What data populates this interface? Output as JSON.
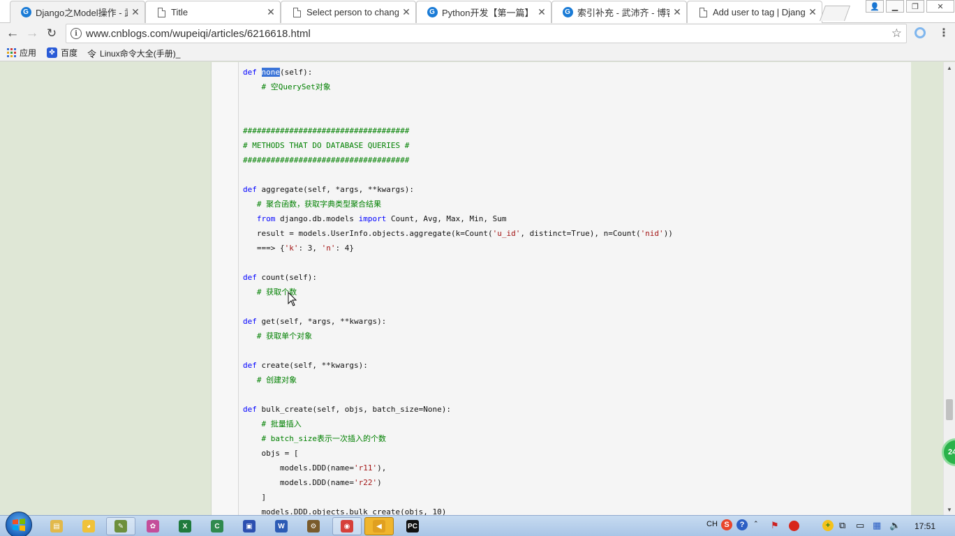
{
  "browser": {
    "tabs": [
      {
        "title": "Django之Model操作 - 武",
        "icon": "cnblogs-icon",
        "active": true
      },
      {
        "title": "Title",
        "icon": "document-icon",
        "active": false
      },
      {
        "title": "Select person to chang",
        "icon": "document-icon",
        "active": false
      },
      {
        "title": "Python开发【第一篇】",
        "icon": "cnblogs-icon",
        "active": false
      },
      {
        "title": "索引补充 - 武沛齐 - 博客",
        "icon": "cnblogs-icon",
        "active": false
      },
      {
        "title": "Add user to tag | Djang",
        "icon": "document-icon",
        "active": false
      }
    ],
    "tab_close_glyph": "✕",
    "address": "www.cnblogs.com/wupeiqi/articles/6216618.html",
    "bookmarks": [
      {
        "label": "应用",
        "icon": "apps-grid-icon"
      },
      {
        "label": "百度",
        "icon": "baidu-paw-icon"
      },
      {
        "label": "Linux命令大全(手册)_",
        "icon": "linux-icon"
      }
    ]
  },
  "code": {
    "lines": [
      [
        {
          "t": "def ",
          "c": "kw"
        },
        {
          "t": "none",
          "c": "sel"
        },
        {
          "t": "(self):",
          "c": ""
        }
      ],
      [
        {
          "t": "    # 空QuerySet对象",
          "c": "cm"
        }
      ],
      [],
      [],
      [
        {
          "t": "####################################",
          "c": "cm"
        }
      ],
      [
        {
          "t": "# METHODS THAT DO DATABASE QUERIES #",
          "c": "cm"
        }
      ],
      [
        {
          "t": "####################################",
          "c": "cm"
        }
      ],
      [],
      [
        {
          "t": "def ",
          "c": "kw"
        },
        {
          "t": "aggregate(self, *args, **kwargs):",
          "c": ""
        }
      ],
      [
        {
          "t": "   # 聚合函数，获取字典类型聚合结果",
          "c": "cm"
        }
      ],
      [
        {
          "t": "   ",
          "c": ""
        },
        {
          "t": "from",
          "c": "kw"
        },
        {
          "t": " django.db.models ",
          "c": ""
        },
        {
          "t": "import",
          "c": "kw"
        },
        {
          "t": " Count, Avg, Max, Min, Sum",
          "c": ""
        }
      ],
      [
        {
          "t": "   result = models.UserInfo.objects.aggregate(k=Count(",
          "c": ""
        },
        {
          "t": "'u_id'",
          "c": "st"
        },
        {
          "t": ", distinct=True), n=Count(",
          "c": ""
        },
        {
          "t": "'nid'",
          "c": "st"
        },
        {
          "t": "))",
          "c": ""
        }
      ],
      [
        {
          "t": "   ===> {",
          "c": ""
        },
        {
          "t": "'k'",
          "c": "st"
        },
        {
          "t": ": 3, ",
          "c": ""
        },
        {
          "t": "'n'",
          "c": "st"
        },
        {
          "t": ": 4}",
          "c": ""
        }
      ],
      [],
      [
        {
          "t": "def ",
          "c": "kw"
        },
        {
          "t": "count(self):",
          "c": ""
        }
      ],
      [
        {
          "t": "   # 获取个数",
          "c": "cm"
        }
      ],
      [],
      [
        {
          "t": "def ",
          "c": "kw"
        },
        {
          "t": "get(self, *args, **kwargs):",
          "c": ""
        }
      ],
      [
        {
          "t": "   # 获取单个对象",
          "c": "cm"
        }
      ],
      [],
      [
        {
          "t": "def ",
          "c": "kw"
        },
        {
          "t": "create(self, **kwargs):",
          "c": ""
        }
      ],
      [
        {
          "t": "   # 创建对象",
          "c": "cm"
        }
      ],
      [],
      [
        {
          "t": "def ",
          "c": "kw"
        },
        {
          "t": "bulk_create(self, objs, batch_size=None):",
          "c": ""
        }
      ],
      [
        {
          "t": "    # 批量插入",
          "c": "cm"
        }
      ],
      [
        {
          "t": "    # batch_size表示一次插入的个数",
          "c": "cm"
        }
      ],
      [
        {
          "t": "    objs = [",
          "c": ""
        }
      ],
      [
        {
          "t": "        models.DDD(name=",
          "c": ""
        },
        {
          "t": "'r11'",
          "c": "st"
        },
        {
          "t": "),",
          "c": ""
        }
      ],
      [
        {
          "t": "        models.DDD(name=",
          "c": ""
        },
        {
          "t": "'r22'",
          "c": "st"
        },
        {
          "t": ")",
          "c": ""
        }
      ],
      [
        {
          "t": "    ]",
          "c": ""
        }
      ],
      [
        {
          "t": "    models.DDD.objects.bulk_create(objs, 10)",
          "c": ""
        }
      ]
    ]
  },
  "floating_badge": "24",
  "taskbar": {
    "apps": [
      {
        "name": "explorer-icon",
        "color": "#e2b94a",
        "glyph": "▤"
      },
      {
        "name": "qq-penguin-icon",
        "color": "#f0c23a",
        "glyph": "◕"
      },
      {
        "name": "notepad-icon",
        "color": "#6d8f3c",
        "glyph": "✎"
      },
      {
        "name": "paint-icon",
        "color": "#c44e9a",
        "glyph": "✿"
      },
      {
        "name": "excel-icon",
        "color": "#1f7a3c",
        "glyph": "X"
      },
      {
        "name": "c-app-icon",
        "color": "#2f8a4e",
        "glyph": "C"
      },
      {
        "name": "save-floppy-icon",
        "color": "#2c4fb0",
        "glyph": "▣"
      },
      {
        "name": "word-icon",
        "color": "#2c5bb5",
        "glyph": "W"
      },
      {
        "name": "tools-icon",
        "color": "#7a5b2c",
        "glyph": "⚙"
      },
      {
        "name": "chrome-icon",
        "color": "#d6403a",
        "glyph": "◉"
      },
      {
        "name": "sound-app-icon",
        "color": "#e0a020",
        "glyph": "◀"
      },
      {
        "name": "pycharm-icon",
        "color": "#111111",
        "glyph": "PC"
      }
    ],
    "tray": {
      "lang": "CH",
      "sogou": "S",
      "help": "?",
      "clock": "17:51"
    }
  }
}
